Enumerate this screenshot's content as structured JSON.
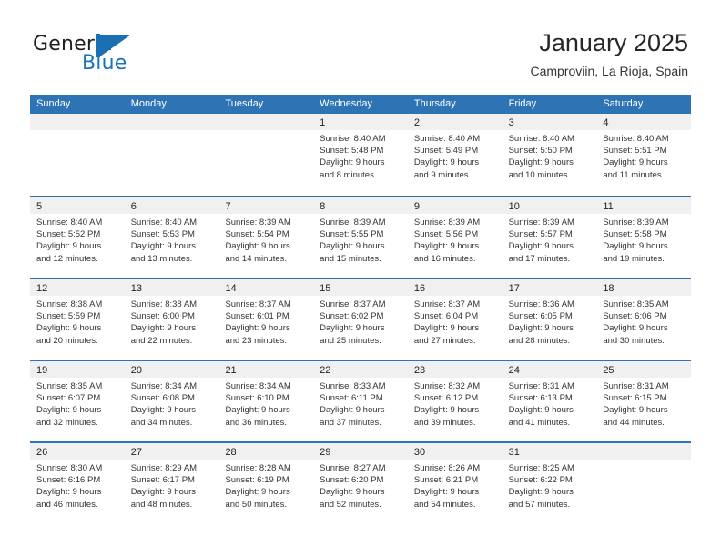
{
  "brand": {
    "word_one": "General",
    "word_two": "Blue",
    "mark": "flag-triangle-logo",
    "color_blue": "#1a6fb5",
    "color_dark": "#231f20"
  },
  "header": {
    "title": "January 2025",
    "subtitle": "Camproviin, La Rioja, Spain"
  },
  "theme": {
    "header_blue": "#2e74b5",
    "band_gray": "#f0f0f0",
    "text": "#333333"
  },
  "calendar": {
    "weekdays": [
      "Sunday",
      "Monday",
      "Tuesday",
      "Wednesday",
      "Thursday",
      "Friday",
      "Saturday"
    ],
    "weeks": [
      [
        {
          "day": "",
          "sunrise": "",
          "sunset": "",
          "daylight_line1": "",
          "daylight_line2": ""
        },
        {
          "day": "",
          "sunrise": "",
          "sunset": "",
          "daylight_line1": "",
          "daylight_line2": ""
        },
        {
          "day": "",
          "sunrise": "",
          "sunset": "",
          "daylight_line1": "",
          "daylight_line2": ""
        },
        {
          "day": "1",
          "sunrise": "Sunrise: 8:40 AM",
          "sunset": "Sunset: 5:48 PM",
          "daylight_line1": "Daylight: 9 hours",
          "daylight_line2": "and 8 minutes."
        },
        {
          "day": "2",
          "sunrise": "Sunrise: 8:40 AM",
          "sunset": "Sunset: 5:49 PM",
          "daylight_line1": "Daylight: 9 hours",
          "daylight_line2": "and 9 minutes."
        },
        {
          "day": "3",
          "sunrise": "Sunrise: 8:40 AM",
          "sunset": "Sunset: 5:50 PM",
          "daylight_line1": "Daylight: 9 hours",
          "daylight_line2": "and 10 minutes."
        },
        {
          "day": "4",
          "sunrise": "Sunrise: 8:40 AM",
          "sunset": "Sunset: 5:51 PM",
          "daylight_line1": "Daylight: 9 hours",
          "daylight_line2": "and 11 minutes."
        }
      ],
      [
        {
          "day": "5",
          "sunrise": "Sunrise: 8:40 AM",
          "sunset": "Sunset: 5:52 PM",
          "daylight_line1": "Daylight: 9 hours",
          "daylight_line2": "and 12 minutes."
        },
        {
          "day": "6",
          "sunrise": "Sunrise: 8:40 AM",
          "sunset": "Sunset: 5:53 PM",
          "daylight_line1": "Daylight: 9 hours",
          "daylight_line2": "and 13 minutes."
        },
        {
          "day": "7",
          "sunrise": "Sunrise: 8:39 AM",
          "sunset": "Sunset: 5:54 PM",
          "daylight_line1": "Daylight: 9 hours",
          "daylight_line2": "and 14 minutes."
        },
        {
          "day": "8",
          "sunrise": "Sunrise: 8:39 AM",
          "sunset": "Sunset: 5:55 PM",
          "daylight_line1": "Daylight: 9 hours",
          "daylight_line2": "and 15 minutes."
        },
        {
          "day": "9",
          "sunrise": "Sunrise: 8:39 AM",
          "sunset": "Sunset: 5:56 PM",
          "daylight_line1": "Daylight: 9 hours",
          "daylight_line2": "and 16 minutes."
        },
        {
          "day": "10",
          "sunrise": "Sunrise: 8:39 AM",
          "sunset": "Sunset: 5:57 PM",
          "daylight_line1": "Daylight: 9 hours",
          "daylight_line2": "and 17 minutes."
        },
        {
          "day": "11",
          "sunrise": "Sunrise: 8:39 AM",
          "sunset": "Sunset: 5:58 PM",
          "daylight_line1": "Daylight: 9 hours",
          "daylight_line2": "and 19 minutes."
        }
      ],
      [
        {
          "day": "12",
          "sunrise": "Sunrise: 8:38 AM",
          "sunset": "Sunset: 5:59 PM",
          "daylight_line1": "Daylight: 9 hours",
          "daylight_line2": "and 20 minutes."
        },
        {
          "day": "13",
          "sunrise": "Sunrise: 8:38 AM",
          "sunset": "Sunset: 6:00 PM",
          "daylight_line1": "Daylight: 9 hours",
          "daylight_line2": "and 22 minutes."
        },
        {
          "day": "14",
          "sunrise": "Sunrise: 8:37 AM",
          "sunset": "Sunset: 6:01 PM",
          "daylight_line1": "Daylight: 9 hours",
          "daylight_line2": "and 23 minutes."
        },
        {
          "day": "15",
          "sunrise": "Sunrise: 8:37 AM",
          "sunset": "Sunset: 6:02 PM",
          "daylight_line1": "Daylight: 9 hours",
          "daylight_line2": "and 25 minutes."
        },
        {
          "day": "16",
          "sunrise": "Sunrise: 8:37 AM",
          "sunset": "Sunset: 6:04 PM",
          "daylight_line1": "Daylight: 9 hours",
          "daylight_line2": "and 27 minutes."
        },
        {
          "day": "17",
          "sunrise": "Sunrise: 8:36 AM",
          "sunset": "Sunset: 6:05 PM",
          "daylight_line1": "Daylight: 9 hours",
          "daylight_line2": "and 28 minutes."
        },
        {
          "day": "18",
          "sunrise": "Sunrise: 8:35 AM",
          "sunset": "Sunset: 6:06 PM",
          "daylight_line1": "Daylight: 9 hours",
          "daylight_line2": "and 30 minutes."
        }
      ],
      [
        {
          "day": "19",
          "sunrise": "Sunrise: 8:35 AM",
          "sunset": "Sunset: 6:07 PM",
          "daylight_line1": "Daylight: 9 hours",
          "daylight_line2": "and 32 minutes."
        },
        {
          "day": "20",
          "sunrise": "Sunrise: 8:34 AM",
          "sunset": "Sunset: 6:08 PM",
          "daylight_line1": "Daylight: 9 hours",
          "daylight_line2": "and 34 minutes."
        },
        {
          "day": "21",
          "sunrise": "Sunrise: 8:34 AM",
          "sunset": "Sunset: 6:10 PM",
          "daylight_line1": "Daylight: 9 hours",
          "daylight_line2": "and 36 minutes."
        },
        {
          "day": "22",
          "sunrise": "Sunrise: 8:33 AM",
          "sunset": "Sunset: 6:11 PM",
          "daylight_line1": "Daylight: 9 hours",
          "daylight_line2": "and 37 minutes."
        },
        {
          "day": "23",
          "sunrise": "Sunrise: 8:32 AM",
          "sunset": "Sunset: 6:12 PM",
          "daylight_line1": "Daylight: 9 hours",
          "daylight_line2": "and 39 minutes."
        },
        {
          "day": "24",
          "sunrise": "Sunrise: 8:31 AM",
          "sunset": "Sunset: 6:13 PM",
          "daylight_line1": "Daylight: 9 hours",
          "daylight_line2": "and 41 minutes."
        },
        {
          "day": "25",
          "sunrise": "Sunrise: 8:31 AM",
          "sunset": "Sunset: 6:15 PM",
          "daylight_line1": "Daylight: 9 hours",
          "daylight_line2": "and 44 minutes."
        }
      ],
      [
        {
          "day": "26",
          "sunrise": "Sunrise: 8:30 AM",
          "sunset": "Sunset: 6:16 PM",
          "daylight_line1": "Daylight: 9 hours",
          "daylight_line2": "and 46 minutes."
        },
        {
          "day": "27",
          "sunrise": "Sunrise: 8:29 AM",
          "sunset": "Sunset: 6:17 PM",
          "daylight_line1": "Daylight: 9 hours",
          "daylight_line2": "and 48 minutes."
        },
        {
          "day": "28",
          "sunrise": "Sunrise: 8:28 AM",
          "sunset": "Sunset: 6:19 PM",
          "daylight_line1": "Daylight: 9 hours",
          "daylight_line2": "and 50 minutes."
        },
        {
          "day": "29",
          "sunrise": "Sunrise: 8:27 AM",
          "sunset": "Sunset: 6:20 PM",
          "daylight_line1": "Daylight: 9 hours",
          "daylight_line2": "and 52 minutes."
        },
        {
          "day": "30",
          "sunrise": "Sunrise: 8:26 AM",
          "sunset": "Sunset: 6:21 PM",
          "daylight_line1": "Daylight: 9 hours",
          "daylight_line2": "and 54 minutes."
        },
        {
          "day": "31",
          "sunrise": "Sunrise: 8:25 AM",
          "sunset": "Sunset: 6:22 PM",
          "daylight_line1": "Daylight: 9 hours",
          "daylight_line2": "and 57 minutes."
        },
        {
          "day": "",
          "sunrise": "",
          "sunset": "",
          "daylight_line1": "",
          "daylight_line2": ""
        }
      ]
    ]
  }
}
